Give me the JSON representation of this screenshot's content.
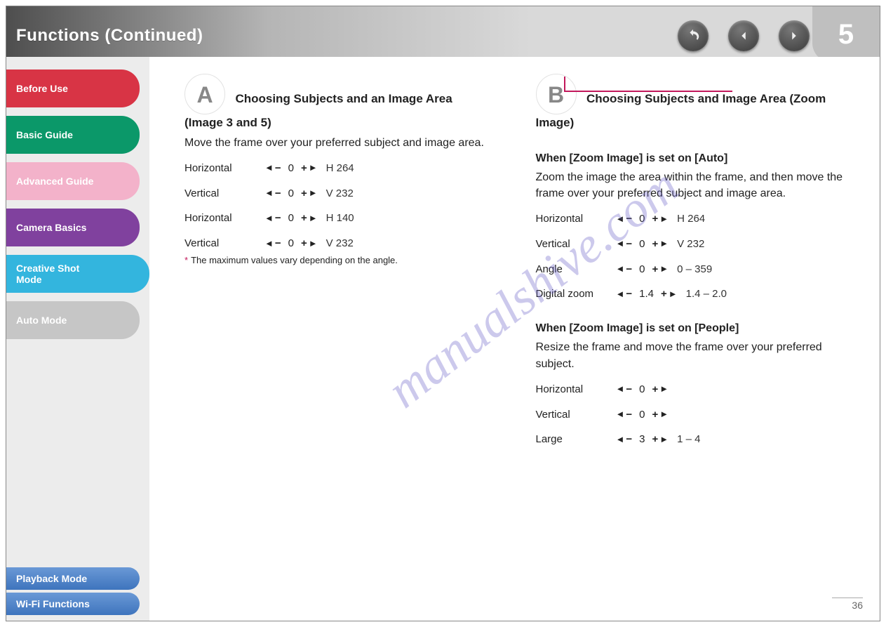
{
  "header": {
    "title": "Functions (Continued)",
    "page_tab": "5"
  },
  "nav": {
    "undo_icon": "undo-icon",
    "prev_icon": "chevron-left-icon",
    "next_icon": "chevron-right-icon"
  },
  "sidebar": {
    "items": [
      {
        "label": "Before Use",
        "color": "red"
      },
      {
        "label": "Basic Guide",
        "color": "green"
      },
      {
        "label": "Advanced Guide",
        "color": "pink"
      },
      {
        "label": "Camera Basics",
        "color": "purple"
      },
      {
        "label": "Creative Shot\nMode",
        "color": "cyan",
        "active": true
      },
      {
        "label": "Auto Mode",
        "color": "grey"
      }
    ],
    "bottom": [
      {
        "label": "Playback Mode"
      },
      {
        "label": "Wi-Fi Functions"
      }
    ]
  },
  "col_a": {
    "letter": "A",
    "title": "Choosing Subjects and an Image Area (Image 3 and 5)",
    "body": "Move the frame over your preferred subject and image area.",
    "settings": [
      {
        "label": "Horizontal",
        "value": "0",
        "unit": "H 264"
      },
      {
        "label": "Vertical",
        "value": "0",
        "unit": "V 232"
      },
      {
        "label": "Horizontal",
        "value": "0",
        "unit": "H 140"
      },
      {
        "label": "Vertical",
        "value": "0",
        "unit": "V 232"
      }
    ],
    "note_star": "*",
    "note": "The maximum values vary depending on the angle."
  },
  "col_b": {
    "letter": "B",
    "title": "Choosing Subjects and Image Area (Zoom Image)",
    "heading": "When [Zoom Image] is set on [Auto]",
    "body": "Zoom the image the area within the frame, and then move the frame over your preferred subject and image area.",
    "settings_auto": [
      {
        "label": "Horizontal",
        "value": "0",
        "unit": "H 264"
      },
      {
        "label": "Vertical",
        "value": "0",
        "unit": "V 232"
      },
      {
        "label": "Angle",
        "value": "0",
        "unit": "0 – 359"
      },
      {
        "label": "Digital zoom",
        "value": "1.4",
        "unit": "1.4 – 2.0"
      }
    ],
    "heading2": "When [Zoom Image] is set on [People]",
    "body2": "Resize the frame and move the frame over your preferred subject.",
    "settings_people": [
      {
        "label": "Horizontal",
        "value": "0",
        "unit": ""
      },
      {
        "label": "Vertical",
        "value": "0",
        "unit": ""
      },
      {
        "label": "Large",
        "value": "3",
        "unit": "1 – 4"
      }
    ]
  },
  "watermark": "manualshive.com",
  "page_no": "36"
}
